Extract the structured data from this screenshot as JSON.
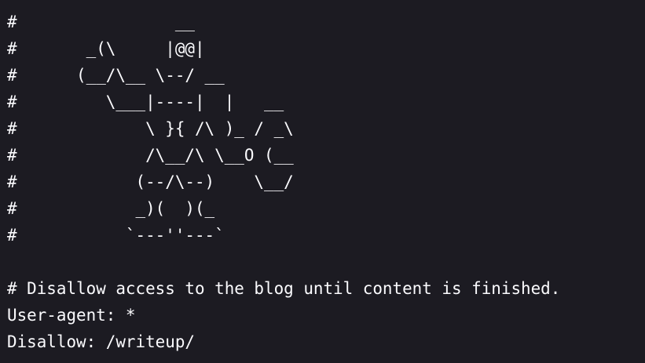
{
  "document": {
    "background_color": "#1c1b22",
    "text_color": "#fbfbfe",
    "lines": [
      "#                __",
      "#       _(\\     |@@|",
      "#      (__/\\__ \\--/ __",
      "#         \\___|----|  |   __",
      "#             \\ }{ /\\ )_ / _\\",
      "#             /\\__/\\ \\__O (__",
      "#            (--/\\--)    \\__/",
      "#            _)(  )(_",
      "#           `---''---`",
      "",
      "# Disallow access to the blog until content is finished.",
      "User-agent: *",
      "Disallow: /writeup/"
    ]
  }
}
